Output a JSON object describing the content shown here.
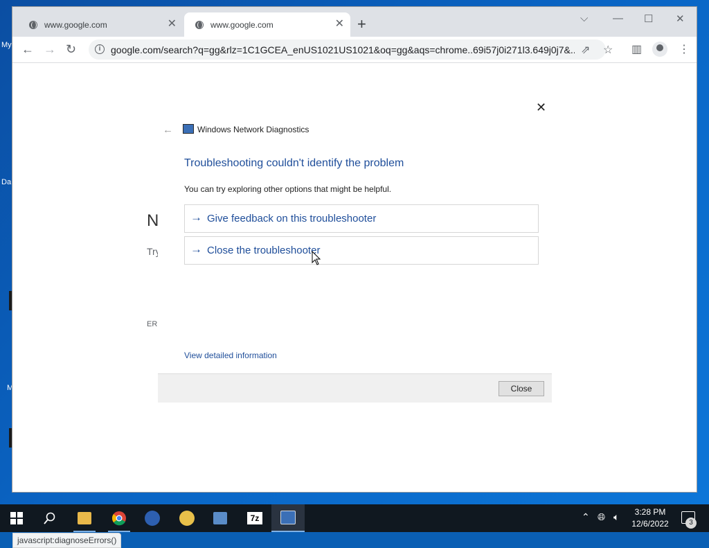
{
  "browser": {
    "tabs": [
      {
        "title": "www.google.com",
        "active": false
      },
      {
        "title": "www.google.com",
        "active": true
      }
    ],
    "address": "google.com/search?q=gg&rlz=1C1GCEA_enUS1021US1021&oq=gg&aqs=chrome..69i57j0i271l3.649j0j7&...",
    "status_url": "javascript:diagnoseErrors()",
    "bg_fragments": {
      "n": "N",
      "try": "Try",
      "err": "ERI"
    }
  },
  "dialog": {
    "app_title": "Windows Network Diagnostics",
    "heading": "Troubleshooting couldn't identify the problem",
    "subtext": "You can try exploring other options that might be helpful.",
    "options": [
      {
        "label": "Give feedback on this troubleshooter"
      },
      {
        "label": "Close the troubleshooter"
      }
    ],
    "detail_link": "View detailed information",
    "close_button": "Close"
  },
  "desktop": {
    "fragments": [
      "My",
      "Da",
      "M"
    ]
  },
  "taskbar": {
    "time": "3:28 PM",
    "date": "12/6/2022",
    "notification_count": "3",
    "apps": [
      "windows-start",
      "search",
      "file-explorer",
      "chrome",
      "app-blue",
      "app-magnifier-folder",
      "app-magnifier",
      "7zip",
      "network-diagnostics"
    ]
  },
  "colors": {
    "accent": "#1f4e9a",
    "taskbar": "#101820",
    "desktop": "#0a63c2"
  }
}
